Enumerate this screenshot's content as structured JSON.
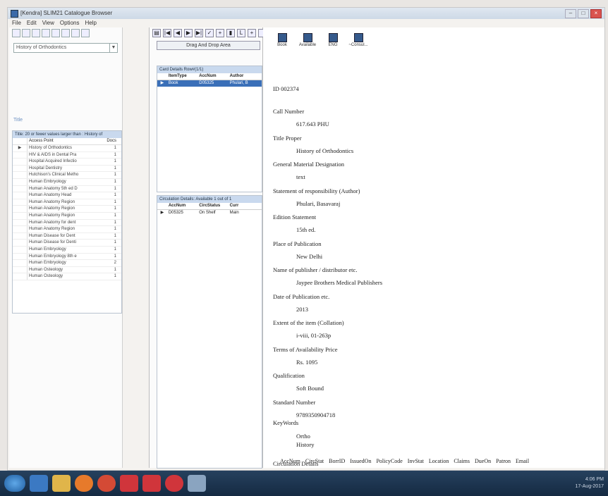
{
  "window": {
    "title": "[Kendra] SLIM21 Catalogue Browser"
  },
  "menu": [
    "File",
    "Edit",
    "View",
    "Options",
    "Help"
  ],
  "left": {
    "combo_value": "History of Orthodontics",
    "filter_label": "Title",
    "grid_header": "Title: 20 or fewer values larger than : History of",
    "columns": [
      "Access Point",
      "Docs"
    ],
    "rows": [
      [
        "History of Orthodontics",
        "1"
      ],
      [
        "HIV & AIDS in Dental Pra",
        "1"
      ],
      [
        "Hospital Acquired Infectio",
        "1"
      ],
      [
        "Hospital Dentistry",
        "1"
      ],
      [
        "Hutchison's Clinical Metho",
        "1"
      ],
      [
        "Human Embryology",
        "1"
      ],
      [
        "Human Anatomy 5th ed D",
        "1"
      ],
      [
        "Human Anatomy Head",
        "1"
      ],
      [
        "Human Anatomy Region",
        "1"
      ],
      [
        "Human Anatomy Region",
        "1"
      ],
      [
        "Human Anatomy Region",
        "1"
      ],
      [
        "Human Anatomy for dent",
        "1"
      ],
      [
        "Human Anatomy Region",
        "1"
      ],
      [
        "Human Disease for Dent",
        "1"
      ],
      [
        "Human Disease for Denti",
        "1"
      ],
      [
        "Human Embryology",
        "1"
      ],
      [
        "Human Embryology 8th e",
        "1"
      ],
      [
        "Human Embryology",
        "2"
      ],
      [
        "Human Osteology",
        "1"
      ],
      [
        "Human Osteology",
        "1"
      ]
    ]
  },
  "middle": {
    "drag_area": "Drag And Drop Area",
    "card_header": "Card Details  Row#(1/1)",
    "card_columns": [
      "ItemType",
      "AccNum",
      "Author"
    ],
    "card_rows": [
      [
        "Book",
        "D05325",
        "Phulari, B"
      ]
    ],
    "circ_header": "Circulation Details: Available 1 out of 1",
    "circ_columns": [
      "AccNum",
      "CircStatus",
      "Curr"
    ],
    "circ_rows": [
      [
        "D05325",
        "On Shelf",
        "Main"
      ]
    ]
  },
  "right": {
    "toolbar": [
      {
        "icon": "book-icon",
        "label": "Book"
      },
      {
        "icon": "available-icon",
        "label": "Available"
      },
      {
        "icon": "language-icon",
        "label": "ENG"
      },
      {
        "icon": "nonconsult-icon",
        "label": "~Consul..."
      }
    ],
    "id_line": "ID 002374",
    "fields": [
      {
        "label": "Call Number",
        "value": "617.643 PHU"
      },
      {
        "label": "Title Proper",
        "value": "History of Orthodontics"
      },
      {
        "label": "General Material Designation",
        "value": "text"
      },
      {
        "label": "Statement of responsibility (Author)",
        "value": "Phulari, Basavaraj"
      },
      {
        "label": "Edition Statement",
        "value": "15th ed."
      },
      {
        "label": "Place of Publication",
        "value": "New Delhi"
      },
      {
        "label": "Name of publisher / distributor etc.",
        "value": "Jaypee Brothers Medical Publishers"
      },
      {
        "label": "Date of Publication etc.",
        "value": "2013"
      },
      {
        "label": "Extent of the item (Collation)",
        "value": "i-viii, 01-263p"
      },
      {
        "label": "Terms of Availability  Price",
        "value": "Rs. 1095"
      },
      {
        "label": "Qualification",
        "value": "Soft Bound"
      },
      {
        "label": "Standard Number",
        "value": "9789350904718"
      }
    ],
    "keywords_label": "KeyWords",
    "keywords": [
      "Ortho",
      "History"
    ],
    "circ_label": "Circulation Details",
    "circ_columns": [
      "AccNum",
      "CircStat",
      "BorrID",
      "IssuedOn",
      "PolicyCode",
      "InvStat",
      "Location",
      "Claims",
      "DueOn",
      "Patron",
      "Email"
    ]
  },
  "taskbar": {
    "time": "4:06 PM",
    "date": "17-Aug-2017"
  },
  "colors": {
    "accent": "#3a6fb8",
    "grid_header": "#c9d9ee",
    "taskbar": "#1d3550"
  }
}
